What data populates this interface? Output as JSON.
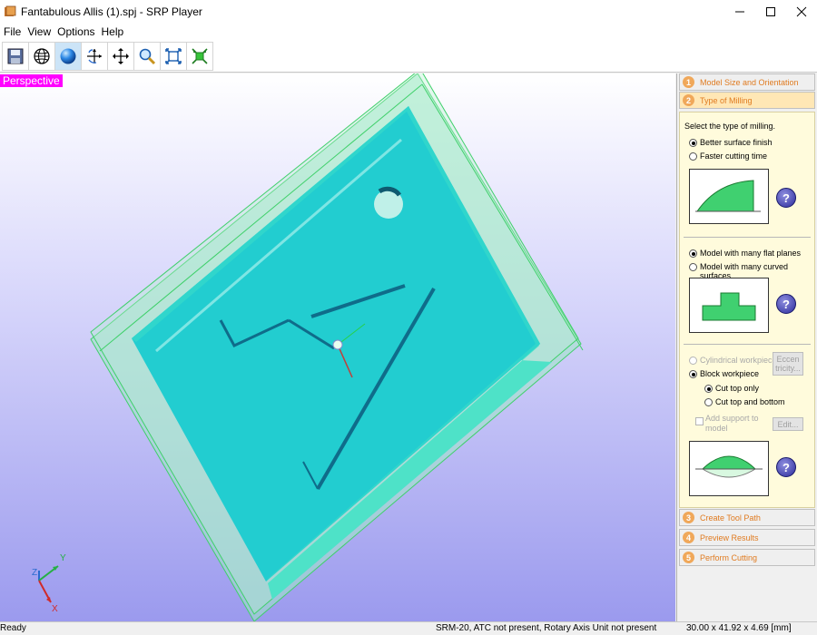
{
  "window": {
    "title": "Fantabulous Allis (1).spj - SRP Player",
    "icon": "app-icon"
  },
  "menu": [
    "File",
    "View",
    "Options",
    "Help"
  ],
  "toolbar": {
    "icons": [
      "save-icon",
      "globe-wireframe-icon",
      "sphere-shaded-icon",
      "rotate-axes-icon",
      "pan-move-icon",
      "zoom-magnifier-icon",
      "fit-extents-icon",
      "zoom-center-icon"
    ]
  },
  "viewport": {
    "view_label": "Perspective",
    "axes": {
      "x": "X",
      "y": "Y",
      "z": "Z"
    }
  },
  "panel": {
    "steps": [
      {
        "num": "1",
        "label": "Model Size and Orientation"
      },
      {
        "num": "2",
        "label": "Type of Milling"
      },
      {
        "num": "3",
        "label": "Create Tool Path"
      },
      {
        "num": "4",
        "label": "Preview Results"
      },
      {
        "num": "5",
        "label": "Perform Cutting"
      }
    ],
    "milling": {
      "prompt": "Select the type of milling.",
      "opt_better": "Better surface finish",
      "opt_faster": "Faster cutting time",
      "opt_flat": "Model with many flat planes",
      "opt_curved": "Model with many curved surfaces",
      "opt_cylindrical": "Cylindrical workpiece",
      "opt_block": "Block workpiece",
      "opt_top": "Cut top only",
      "opt_topbottom": "Cut top and bottom",
      "support_line1": "Add support to",
      "support_line2": "model",
      "eccen_line1": "Eccen",
      "eccen_line2": "tricity...",
      "edit_label": "Edit...",
      "help_glyph": "?"
    }
  },
  "status": {
    "left": "Ready",
    "middle": "SRM-20, ATC not present, Rotary Axis Unit not present",
    "right": "30.00 x  41.92 x   4.69 [mm]"
  },
  "colors": {
    "model_face": "#22cdd0",
    "stock": "#a8f0c4",
    "highlight": "#ff00ff",
    "step_text": "#e07b20",
    "panel_bg": "#fffbdc"
  }
}
